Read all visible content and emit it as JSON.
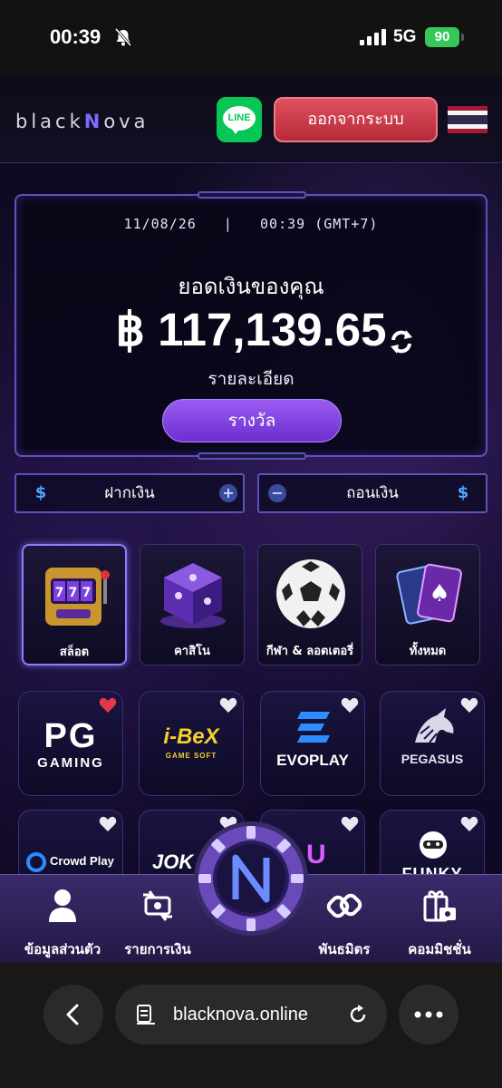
{
  "status": {
    "time": "00:39",
    "network": "5G",
    "battery": "90"
  },
  "header": {
    "logo_left": "black",
    "logo_n": "N",
    "logo_right": "ova",
    "line_label": "LINE",
    "logout_label": "ออกจากระบบ",
    "flag_icon": "thailand-flag-icon"
  },
  "balance": {
    "date": "11/08/26",
    "separator": "|",
    "time": "00:39 (GMT+7)",
    "label": "ยอดเงินของคุณ",
    "amount": "฿ 117,139.65",
    "detail": "รายละเอียด",
    "reward_label": "รางวัล"
  },
  "actions": {
    "deposit_label": "ฝากเงิน",
    "withdraw_label": "ถอนเงิน",
    "currency_symbol": "$"
  },
  "categories": [
    {
      "label": "สล็อต",
      "active": true
    },
    {
      "label": "คาสิโน",
      "active": false
    },
    {
      "label": "กีฬา & ลอตเตอรี่",
      "active": false
    },
    {
      "label": "ทั้งหมด",
      "active": false
    }
  ],
  "providers": {
    "pg_top": "PG",
    "pg_bottom": "GAMING",
    "ibex_top": "i-BeX",
    "ibex_bottom": "GAME SOFT",
    "evoplay": "EVOPLAY",
    "pegasus": "PEGASUS",
    "crowdplay": "Crowd Play",
    "joker": "JOK",
    "third_partial": "U",
    "funky": "FUNKY"
  },
  "colors": {
    "accent": "#7d6cff",
    "logout": "#d03c4c",
    "line": "#06c755",
    "heart_active": "#e5384a"
  },
  "nav": [
    {
      "label": "ข้อมูลส่วนตัว",
      "icon": "user-icon"
    },
    {
      "label": "รายการเงิน",
      "icon": "transactions-icon"
    },
    {
      "label": "พันธมิตร",
      "icon": "partner-link-icon"
    },
    {
      "label": "คอมมิชชั่น",
      "icon": "commission-gift-icon"
    }
  ],
  "browser": {
    "url": "blacknova.online"
  }
}
